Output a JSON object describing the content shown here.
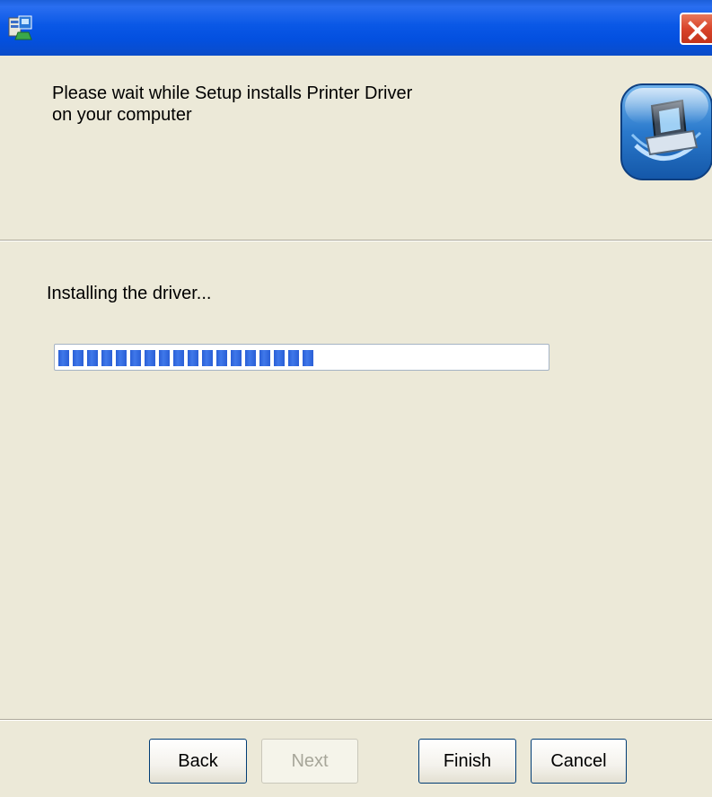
{
  "window": {
    "title": "",
    "close_icon": "close-icon"
  },
  "header": {
    "message_line1": "Please wait while Setup installs Printer Driver",
    "message_line2": "on your computer"
  },
  "status": {
    "text": "Installing the driver...",
    "progress_percent": 53
  },
  "buttons": {
    "back": "Back",
    "next": "Next",
    "finish": "Finish",
    "cancel": "Cancel"
  },
  "colors": {
    "titlebar": "#0a58e6",
    "progress": "#2a5fd6",
    "close": "#d9442a"
  }
}
